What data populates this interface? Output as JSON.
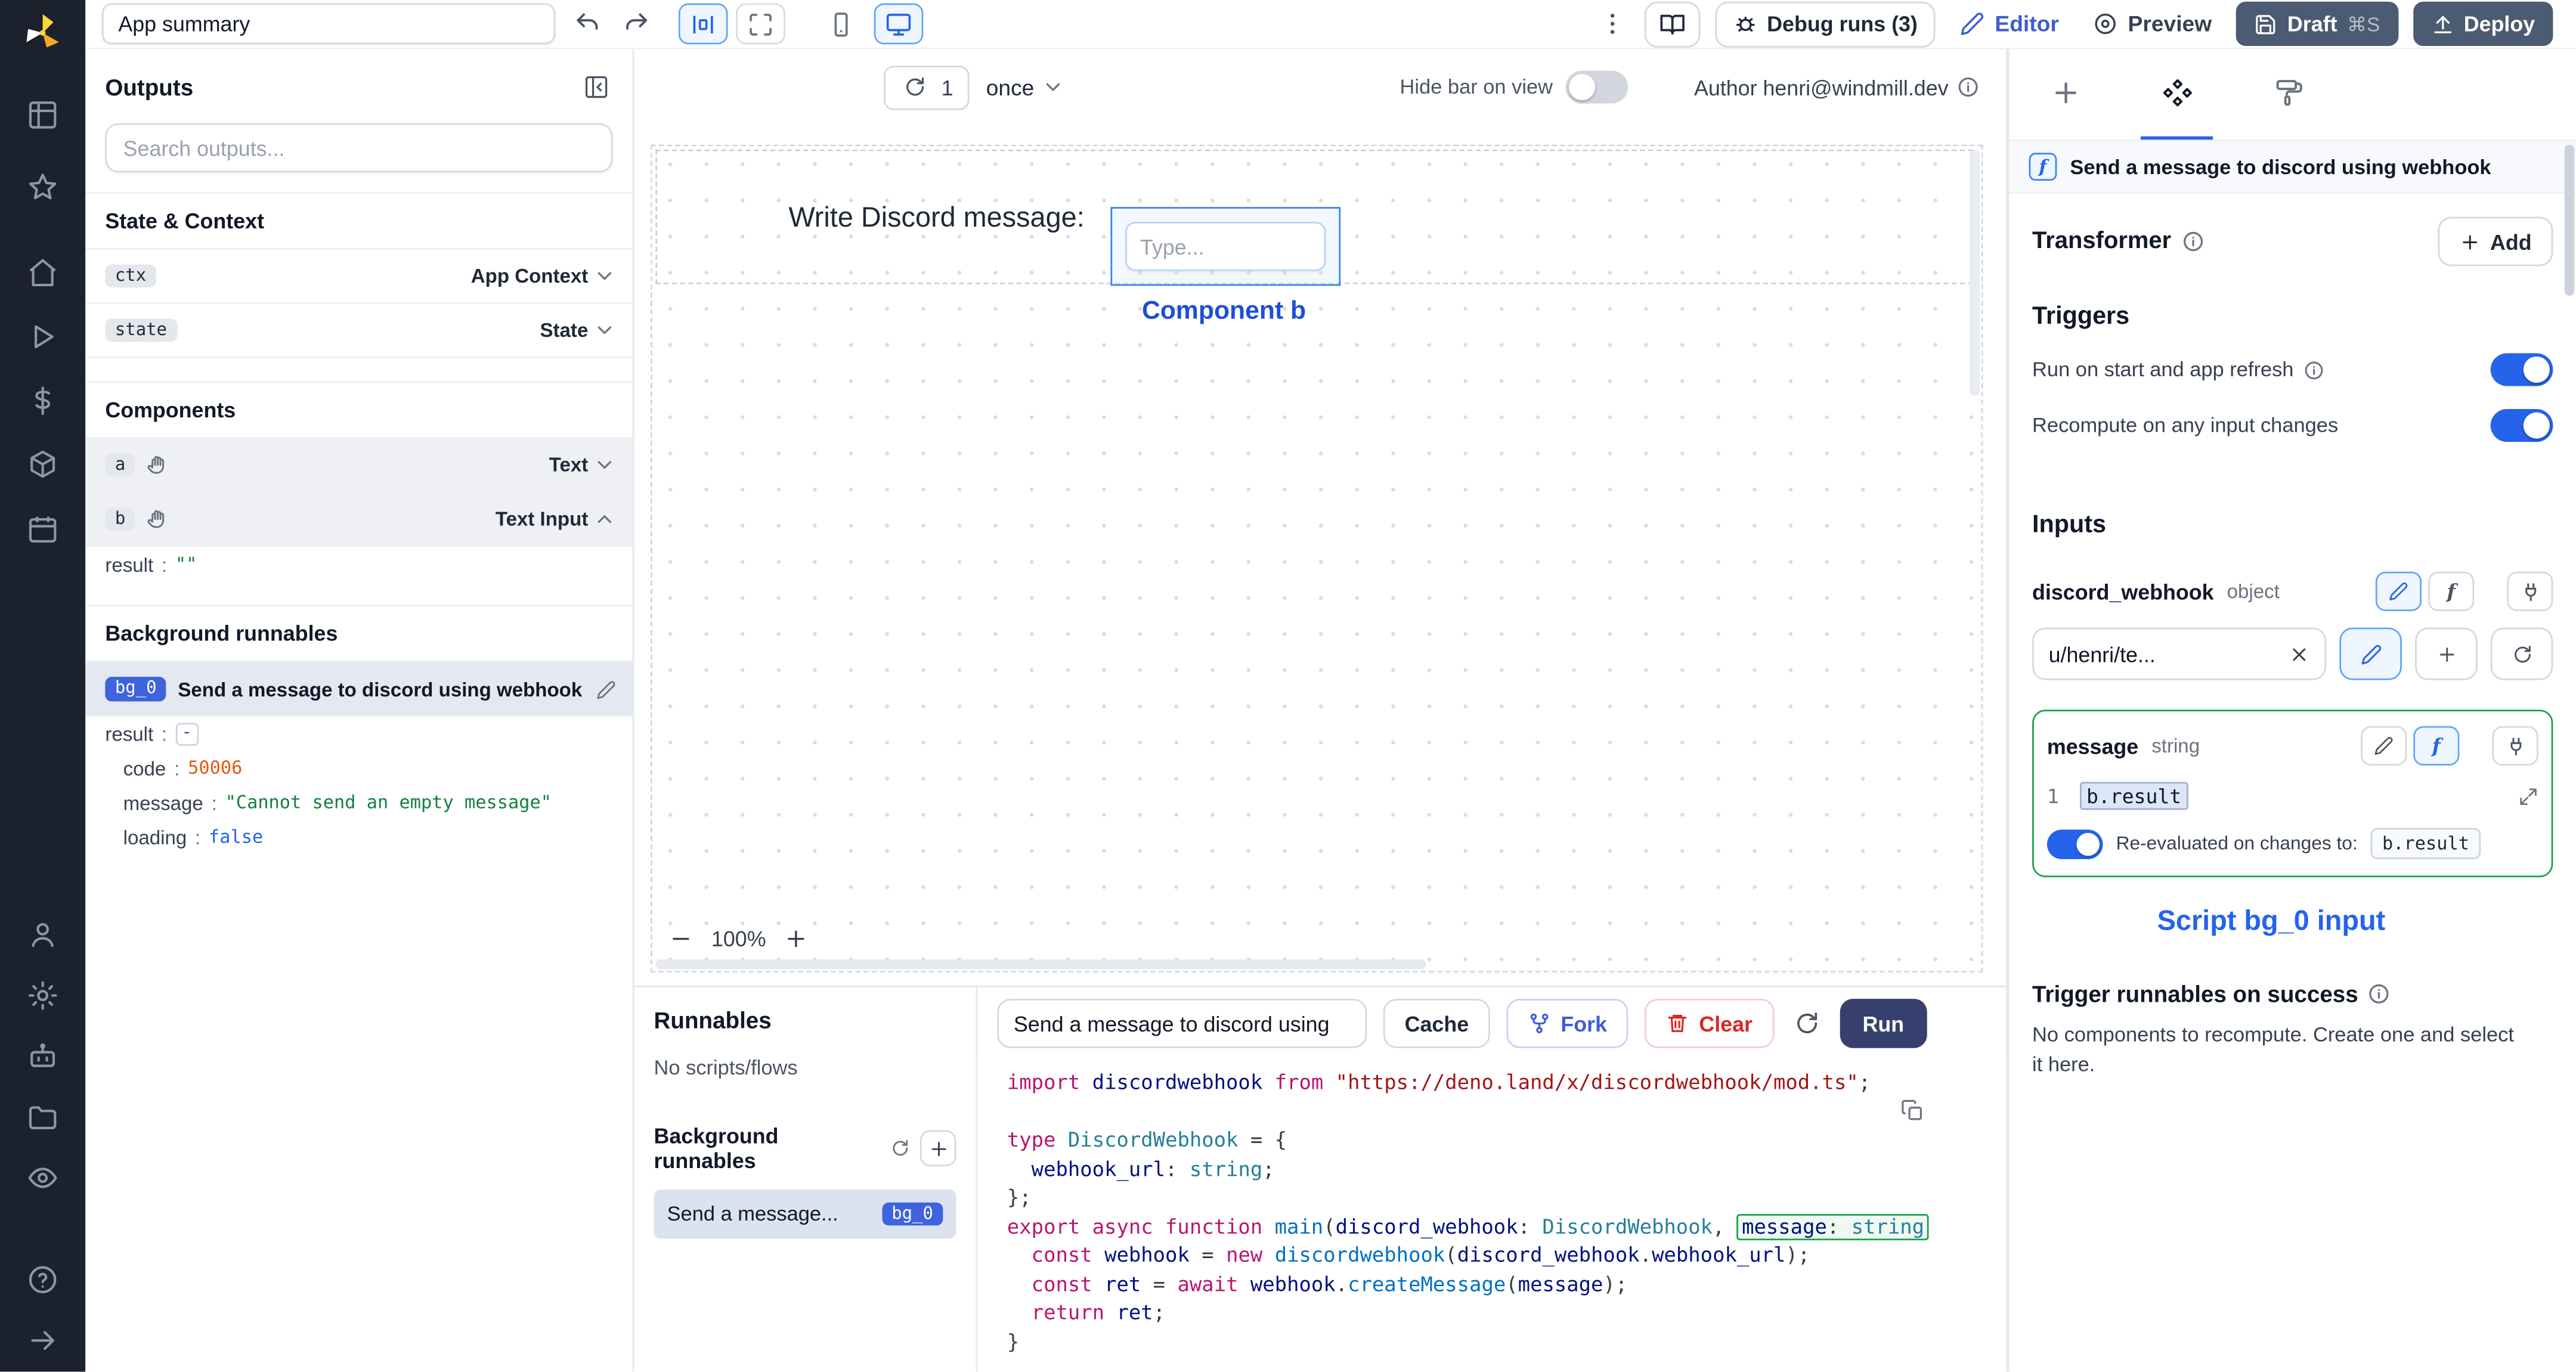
{
  "colors": {
    "accent_blue": "#2563eb",
    "rail_bg": "#1c212e",
    "dark_button": "#4b5b72",
    "run_button": "#35406e",
    "badge_blue": "#3e63dd",
    "connected_green": "#16a34a",
    "string_green": "#15803d",
    "number_orange": "#ea580c",
    "bool_blue": "#2563eb"
  },
  "icons": {
    "rail": [
      "windmill-logo",
      "grid",
      "star",
      "home",
      "play",
      "dollar",
      "cube",
      "calendar",
      "user",
      "gear",
      "robot",
      "folder",
      "eye",
      "help",
      "arrow-right"
    ],
    "toolbar": [
      "undo",
      "redo",
      "center-layout",
      "maximize",
      "smartphone",
      "monitor",
      "kebab",
      "book",
      "bug",
      "pencil",
      "circle-dot",
      "save",
      "upload"
    ],
    "misc": [
      "refresh",
      "chevron-down",
      "chevron-up",
      "info",
      "hand",
      "plus",
      "function-f",
      "plug",
      "x",
      "git-fork",
      "trash",
      "copy",
      "expand-diagonal",
      "collapse-panel"
    ]
  },
  "topbar": {
    "app_summary": "App summary",
    "debug_runs_label": "Debug runs (3)",
    "editor_label": "Editor",
    "preview_label": "Preview",
    "draft_label": "Draft",
    "draft_shortcut": "⌘S",
    "deploy_label": "Deploy"
  },
  "left_panel": {
    "sep": ":",
    "outputs_title": "Outputs",
    "search_placeholder": "Search outputs...",
    "sections": {
      "state_context": "State & Context",
      "components": "Components",
      "background_runnables": "Background runnables"
    },
    "rows": {
      "ctx": {
        "badge": "ctx",
        "type": "App Context"
      },
      "state": {
        "badge": "state",
        "type": "State"
      },
      "a": {
        "badge": "a",
        "type": "Text"
      },
      "b": {
        "badge": "b",
        "type": "Text Input"
      }
    },
    "b_result": {
      "key": "result",
      "value": "\"\""
    },
    "bg0": {
      "badge": "bg_0",
      "name": "Send a message to discord using webhook",
      "result_key": "result",
      "collapse": "-",
      "code_key": "code",
      "code_value": "50006",
      "message_key": "message",
      "message_value": "\"Cannot send an empty message\"",
      "loading_key": "loading",
      "loading_value": "false"
    }
  },
  "canvas": {
    "refresh_count": "1",
    "mode": "once",
    "hide_bar_label": "Hide bar on view",
    "author": "Author henri@windmill.dev",
    "text_component": "Write Discord message:",
    "input_placeholder": "Type...",
    "selection_label": "Component b",
    "zoom": "100%"
  },
  "runnables": {
    "title": "Runnables",
    "empty": "No scripts/flows",
    "bg_title": "Background runnables",
    "item_name": "Send a message...",
    "item_badge": "bg_0"
  },
  "editor": {
    "script_name": "Send a message to discord using",
    "cache_label": "Cache",
    "fork_label": "Fork",
    "clear_label": "Clear",
    "run_label": "Run",
    "code_lines": [
      [
        {
          "c": "kw",
          "v": "import "
        },
        {
          "c": "id",
          "v": "discordwebhook"
        },
        {
          "c": "pl",
          "v": " "
        },
        {
          "c": "kw",
          "v": "from "
        },
        {
          "c": "str",
          "v": "\"https://deno.land/x/discordwebhook/mod.ts\""
        },
        {
          "c": "pl",
          "v": ";"
        }
      ],
      [],
      [
        {
          "c": "kw",
          "v": "type "
        },
        {
          "c": "ty",
          "v": "DiscordWebhook"
        },
        {
          "c": "pl",
          "v": " = {"
        }
      ],
      [
        {
          "c": "pl",
          "v": "  "
        },
        {
          "c": "id",
          "v": "webhook_url"
        },
        {
          "c": "pl",
          "v": ": "
        },
        {
          "c": "ty",
          "v": "string"
        },
        {
          "c": "pl",
          "v": ";"
        }
      ],
      [
        {
          "c": "pl",
          "v": "};"
        }
      ],
      [
        {
          "c": "kw",
          "v": "export async function "
        },
        {
          "c": "fn",
          "v": "main"
        },
        {
          "c": "pl",
          "v": "("
        },
        {
          "c": "id",
          "v": "discord_webhook"
        },
        {
          "c": "pl",
          "v": ": "
        },
        {
          "c": "ty",
          "v": "DiscordWebhook"
        },
        {
          "c": "pl",
          "v": ", "
        },
        {
          "c": "box",
          "v": [
            {
              "c": "id",
              "v": "message"
            },
            {
              "c": "pl",
              "v": ": "
            },
            {
              "c": "ty",
              "v": "string"
            }
          ]
        }
      ],
      [
        {
          "c": "pl",
          "v": "  "
        },
        {
          "c": "kw",
          "v": "const "
        },
        {
          "c": "id",
          "v": "webhook"
        },
        {
          "c": "pl",
          "v": " = "
        },
        {
          "c": "kw",
          "v": "new "
        },
        {
          "c": "fn",
          "v": "discordwebhook"
        },
        {
          "c": "pl",
          "v": "("
        },
        {
          "c": "id",
          "v": "discord_webhook"
        },
        {
          "c": "pl",
          "v": "."
        },
        {
          "c": "id",
          "v": "webhook_url"
        },
        {
          "c": "pl",
          "v": ");"
        }
      ],
      [
        {
          "c": "pl",
          "v": "  "
        },
        {
          "c": "kw",
          "v": "const "
        },
        {
          "c": "id",
          "v": "ret"
        },
        {
          "c": "pl",
          "v": " = "
        },
        {
          "c": "kw",
          "v": "await "
        },
        {
          "c": "id",
          "v": "webhook"
        },
        {
          "c": "pl",
          "v": "."
        },
        {
          "c": "fn",
          "v": "createMessage"
        },
        {
          "c": "pl",
          "v": "("
        },
        {
          "c": "id",
          "v": "message"
        },
        {
          "c": "pl",
          "v": ");"
        }
      ],
      [
        {
          "c": "pl",
          "v": "  "
        },
        {
          "c": "kw",
          "v": "return "
        },
        {
          "c": "id",
          "v": "ret"
        },
        {
          "c": "pl",
          "v": ";"
        }
      ],
      [
        {
          "c": "pl",
          "v": "}"
        }
      ]
    ]
  },
  "right_panel": {
    "header": "Send a message to discord using webhook",
    "transformer_label": "Transformer",
    "add_label": "Add",
    "triggers_title": "Triggers",
    "trigger_rows": [
      "Run on start and app refresh",
      "Recompute on any input changes"
    ],
    "inputs_title": "Inputs",
    "discord_webhook": {
      "name": "discord_webhook",
      "type": "object",
      "value": "u/henri/te..."
    },
    "message": {
      "name": "message",
      "type": "string",
      "line_no": "1",
      "expr": "b.result"
    },
    "reeval_label": "Re-evaluated on changes to:",
    "reeval_badge": "b.result",
    "script_input_caption": "Script bg_0 input",
    "on_success_title": "Trigger runnables on success",
    "on_success_desc": "No components to recompute. Create one and select it here."
  }
}
